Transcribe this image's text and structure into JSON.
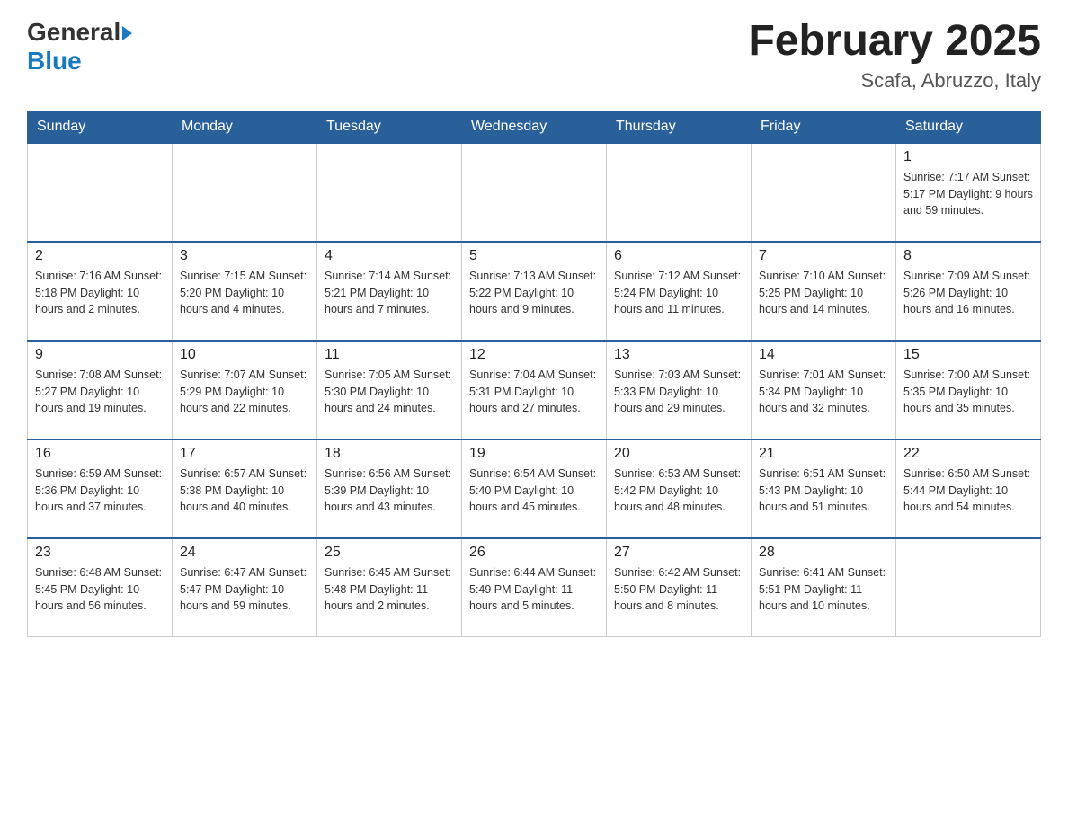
{
  "header": {
    "logo_general": "General",
    "logo_blue": "Blue",
    "title": "February 2025",
    "subtitle": "Scafa, Abruzzo, Italy"
  },
  "calendar": {
    "days": [
      "Sunday",
      "Monday",
      "Tuesday",
      "Wednesday",
      "Thursday",
      "Friday",
      "Saturday"
    ],
    "weeks": [
      {
        "cells": [
          {
            "day": "",
            "info": ""
          },
          {
            "day": "",
            "info": ""
          },
          {
            "day": "",
            "info": ""
          },
          {
            "day": "",
            "info": ""
          },
          {
            "day": "",
            "info": ""
          },
          {
            "day": "",
            "info": ""
          },
          {
            "day": "1",
            "info": "Sunrise: 7:17 AM\nSunset: 5:17 PM\nDaylight: 9 hours and 59 minutes."
          }
        ]
      },
      {
        "cells": [
          {
            "day": "2",
            "info": "Sunrise: 7:16 AM\nSunset: 5:18 PM\nDaylight: 10 hours and 2 minutes."
          },
          {
            "day": "3",
            "info": "Sunrise: 7:15 AM\nSunset: 5:20 PM\nDaylight: 10 hours and 4 minutes."
          },
          {
            "day": "4",
            "info": "Sunrise: 7:14 AM\nSunset: 5:21 PM\nDaylight: 10 hours and 7 minutes."
          },
          {
            "day": "5",
            "info": "Sunrise: 7:13 AM\nSunset: 5:22 PM\nDaylight: 10 hours and 9 minutes."
          },
          {
            "day": "6",
            "info": "Sunrise: 7:12 AM\nSunset: 5:24 PM\nDaylight: 10 hours and 11 minutes."
          },
          {
            "day": "7",
            "info": "Sunrise: 7:10 AM\nSunset: 5:25 PM\nDaylight: 10 hours and 14 minutes."
          },
          {
            "day": "8",
            "info": "Sunrise: 7:09 AM\nSunset: 5:26 PM\nDaylight: 10 hours and 16 minutes."
          }
        ]
      },
      {
        "cells": [
          {
            "day": "9",
            "info": "Sunrise: 7:08 AM\nSunset: 5:27 PM\nDaylight: 10 hours and 19 minutes."
          },
          {
            "day": "10",
            "info": "Sunrise: 7:07 AM\nSunset: 5:29 PM\nDaylight: 10 hours and 22 minutes."
          },
          {
            "day": "11",
            "info": "Sunrise: 7:05 AM\nSunset: 5:30 PM\nDaylight: 10 hours and 24 minutes."
          },
          {
            "day": "12",
            "info": "Sunrise: 7:04 AM\nSunset: 5:31 PM\nDaylight: 10 hours and 27 minutes."
          },
          {
            "day": "13",
            "info": "Sunrise: 7:03 AM\nSunset: 5:33 PM\nDaylight: 10 hours and 29 minutes."
          },
          {
            "day": "14",
            "info": "Sunrise: 7:01 AM\nSunset: 5:34 PM\nDaylight: 10 hours and 32 minutes."
          },
          {
            "day": "15",
            "info": "Sunrise: 7:00 AM\nSunset: 5:35 PM\nDaylight: 10 hours and 35 minutes."
          }
        ]
      },
      {
        "cells": [
          {
            "day": "16",
            "info": "Sunrise: 6:59 AM\nSunset: 5:36 PM\nDaylight: 10 hours and 37 minutes."
          },
          {
            "day": "17",
            "info": "Sunrise: 6:57 AM\nSunset: 5:38 PM\nDaylight: 10 hours and 40 minutes."
          },
          {
            "day": "18",
            "info": "Sunrise: 6:56 AM\nSunset: 5:39 PM\nDaylight: 10 hours and 43 minutes."
          },
          {
            "day": "19",
            "info": "Sunrise: 6:54 AM\nSunset: 5:40 PM\nDaylight: 10 hours and 45 minutes."
          },
          {
            "day": "20",
            "info": "Sunrise: 6:53 AM\nSunset: 5:42 PM\nDaylight: 10 hours and 48 minutes."
          },
          {
            "day": "21",
            "info": "Sunrise: 6:51 AM\nSunset: 5:43 PM\nDaylight: 10 hours and 51 minutes."
          },
          {
            "day": "22",
            "info": "Sunrise: 6:50 AM\nSunset: 5:44 PM\nDaylight: 10 hours and 54 minutes."
          }
        ]
      },
      {
        "cells": [
          {
            "day": "23",
            "info": "Sunrise: 6:48 AM\nSunset: 5:45 PM\nDaylight: 10 hours and 56 minutes."
          },
          {
            "day": "24",
            "info": "Sunrise: 6:47 AM\nSunset: 5:47 PM\nDaylight: 10 hours and 59 minutes."
          },
          {
            "day": "25",
            "info": "Sunrise: 6:45 AM\nSunset: 5:48 PM\nDaylight: 11 hours and 2 minutes."
          },
          {
            "day": "26",
            "info": "Sunrise: 6:44 AM\nSunset: 5:49 PM\nDaylight: 11 hours and 5 minutes."
          },
          {
            "day": "27",
            "info": "Sunrise: 6:42 AM\nSunset: 5:50 PM\nDaylight: 11 hours and 8 minutes."
          },
          {
            "day": "28",
            "info": "Sunrise: 6:41 AM\nSunset: 5:51 PM\nDaylight: 11 hours and 10 minutes."
          },
          {
            "day": "",
            "info": ""
          }
        ]
      }
    ]
  }
}
